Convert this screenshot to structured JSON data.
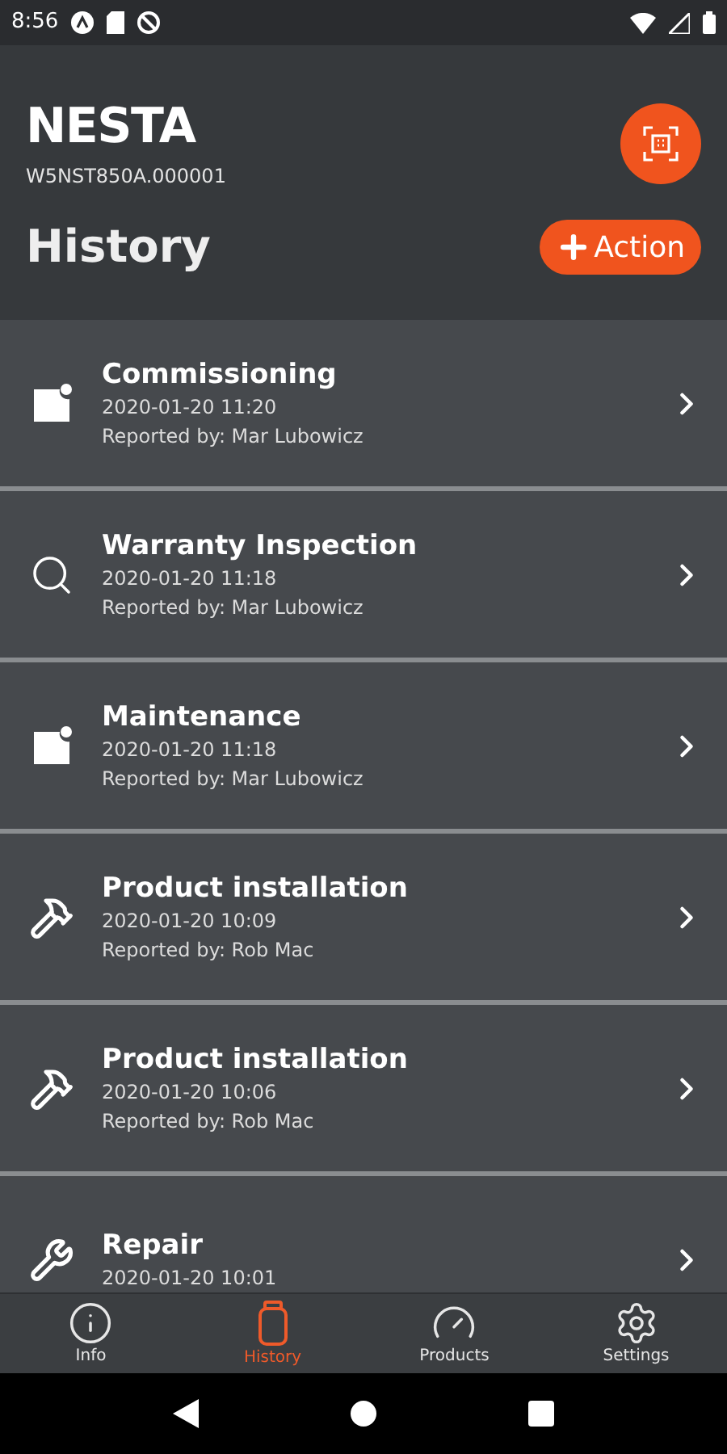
{
  "status_bar": {
    "time": "8:56"
  },
  "header": {
    "brand": "NESTA",
    "serial": "W5NST850A.000001",
    "title": "History",
    "action_button": "Action"
  },
  "history": [
    {
      "kind": "note",
      "title": "Commissioning",
      "date": "2020-01-20 11:20",
      "reporter": "Reported by: Mar Lubowicz"
    },
    {
      "kind": "search",
      "title": "Warranty Inspection",
      "date": "2020-01-20 11:18",
      "reporter": "Reported by: Mar Lubowicz"
    },
    {
      "kind": "note",
      "title": "Maintenance",
      "date": "2020-01-20 11:18",
      "reporter": "Reported by: Mar Lubowicz"
    },
    {
      "kind": "hammer",
      "title": "Product installation",
      "date": "2020-01-20 10:09",
      "reporter": "Reported by: Rob Mac"
    },
    {
      "kind": "hammer",
      "title": "Product installation",
      "date": "2020-01-20 10:06",
      "reporter": "Reported by: Rob Mac"
    },
    {
      "kind": "wrench",
      "title": "Repair",
      "date": "2020-01-20 10:01"
    }
  ],
  "tabs": [
    {
      "kind": "info",
      "label": "Info",
      "selected": false
    },
    {
      "kind": "history",
      "label": "History",
      "selected": true
    },
    {
      "kind": "products",
      "label": "Products",
      "selected": false
    },
    {
      "kind": "settings",
      "label": "Settings",
      "selected": false
    }
  ]
}
